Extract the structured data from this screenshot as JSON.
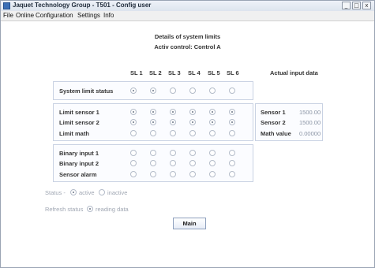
{
  "window": {
    "title": "Jaquet Technology Group - T501 - Config user",
    "controls": [
      "_",
      "□",
      "x"
    ]
  },
  "menu": [
    "File",
    "Online",
    "Configuration",
    "Settings",
    "Info"
  ],
  "header": {
    "title": "Details of system limits",
    "subtitle": "Activ control: Control A"
  },
  "columns": [
    "SL 1",
    "SL 2",
    "SL 3",
    "SL 4",
    "SL 5",
    "SL 6"
  ],
  "actual_input_label": "Actual input data",
  "groups": [
    {
      "rows": [
        {
          "label": "System limit status",
          "values": [
            true,
            true,
            false,
            false,
            false,
            false
          ]
        }
      ]
    },
    {
      "rows": [
        {
          "label": "Limit sensor 1",
          "values": [
            true,
            true,
            true,
            true,
            true,
            true
          ]
        },
        {
          "label": "Limit sensor 2",
          "values": [
            true,
            true,
            true,
            true,
            true,
            true
          ]
        },
        {
          "label": "Limit math",
          "values": [
            false,
            false,
            false,
            false,
            false,
            false
          ]
        }
      ]
    },
    {
      "rows": [
        {
          "label": "Binary input 1",
          "values": [
            false,
            false,
            false,
            false,
            false,
            false
          ]
        },
        {
          "label": "Binary input 2",
          "values": [
            false,
            false,
            false,
            false,
            false,
            false
          ]
        },
        {
          "label": "Sensor alarm",
          "values": [
            false,
            false,
            false,
            false,
            false,
            false
          ]
        }
      ]
    }
  ],
  "actual_inputs": [
    {
      "name": "Sensor 1",
      "value": "1500.00"
    },
    {
      "name": "Sensor 2",
      "value": "1500.00"
    },
    {
      "name": "Math value",
      "value": "0.00000"
    }
  ],
  "status_legend": {
    "label": "Status -",
    "active": "active",
    "inactive": "inactive"
  },
  "refresh": {
    "label": "Refresh status",
    "value": "reading data"
  },
  "main_button": "Main",
  "colors": {
    "panel_border": "#c9d2e3",
    "accent": "#3b6fb6"
  }
}
